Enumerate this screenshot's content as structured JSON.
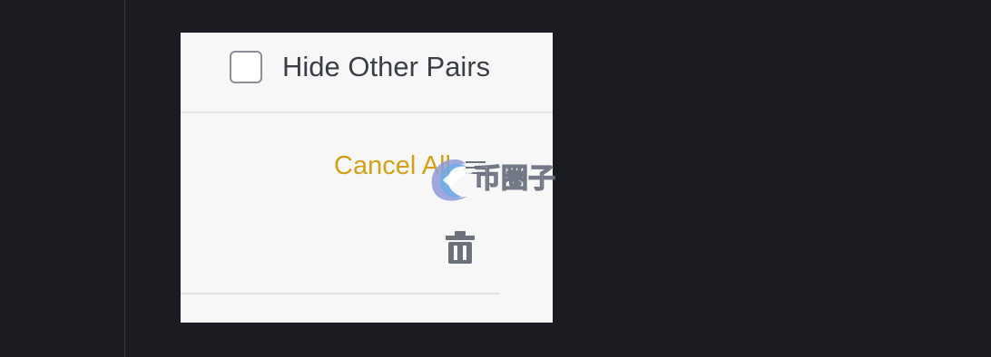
{
  "filter": {
    "hide_other_pairs_label": "Hide Other Pairs",
    "checked": false
  },
  "actions": {
    "cancel_all_label": "Cancel All"
  },
  "icons": {
    "menu": "menu-icon",
    "trash": "trash-icon",
    "watermark": "watermark-logo"
  },
  "watermark": {
    "text": "币圈子"
  },
  "colors": {
    "background": "#1b1c21",
    "panel": "#f7f7f7",
    "accent": "#d4a017",
    "text": "#3a3e46",
    "icon": "#6c717b"
  }
}
